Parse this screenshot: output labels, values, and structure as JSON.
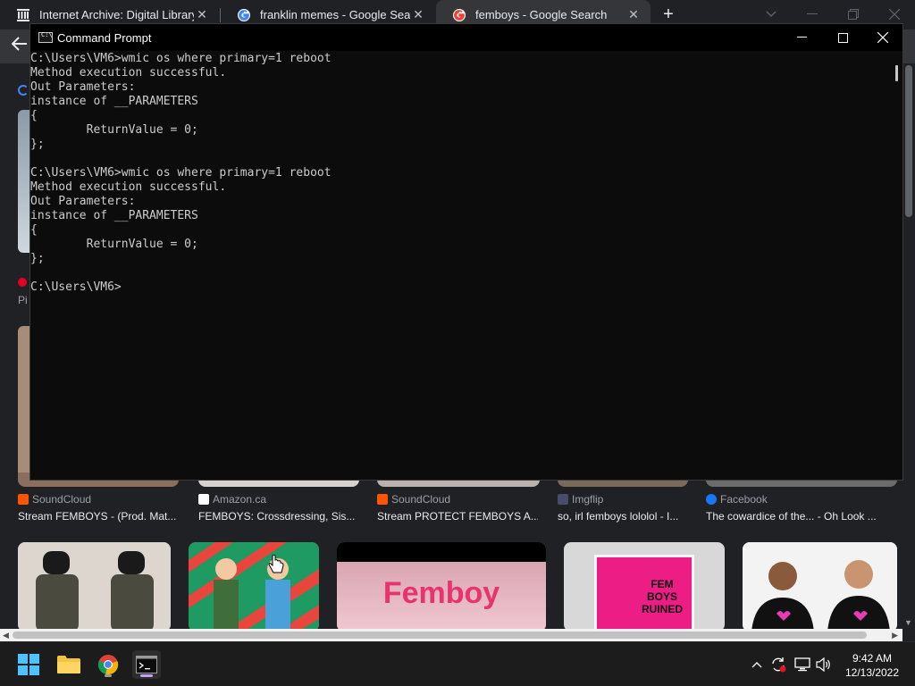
{
  "browser": {
    "tabs": [
      {
        "label": "Internet Archive: Digital Library o",
        "favicon": "archive-icon",
        "active": false
      },
      {
        "label": "franklin memes - Google Search",
        "favicon": "google-icon",
        "active": false
      },
      {
        "label": "femboys - Google Search",
        "favicon": "google-icon",
        "active": true
      }
    ],
    "new_tab_glyph": "+",
    "controls": [
      "chevron-down-icon",
      "minimize-icon",
      "restore-icon",
      "close-icon"
    ]
  },
  "page": {
    "peek_top_text": "Pi",
    "results": [
      {
        "source": "SoundCloud",
        "source_color": "#ff5500",
        "caption": "Stream FEMBOYS - (Prod. Mat..."
      },
      {
        "source": "Amazon.ca",
        "source_color": "#ffffff",
        "caption": "FEMBOYS: Crossdressing, Sis..."
      },
      {
        "source": "SoundCloud",
        "source_color": "#ff5500",
        "caption": "Stream PROTECT FEMBOYS A..."
      },
      {
        "source": "Imgflip",
        "source_color": "#4a4a6a",
        "caption": "so, irl femboys lololol - I..."
      },
      {
        "source": "Facebook",
        "source_color": "#1877f2",
        "caption": "The cowardice of the... - Oh Look ..."
      }
    ],
    "image_texts": {
      "femboy_banner": "Femboy",
      "fem_boys_sign": "FEM BOYS RUINED"
    }
  },
  "cmd": {
    "title": "Command Prompt",
    "output": "C:\\Users\\VM6>wmic os where primary=1 reboot\nMethod execution successful.\nOut Parameters:\ninstance of __PARAMETERS\n{\n        ReturnValue = 0;\n};\n\nC:\\Users\\VM6>wmic os where primary=1 reboot\nMethod execution successful.\nOut Parameters:\ninstance of __PARAMETERS\n{\n        ReturnValue = 0;\n};\n\nC:\\Users\\VM6>"
  },
  "taskbar": {
    "apps": [
      "start-icon",
      "file-explorer-icon",
      "chrome-icon",
      "terminal-icon"
    ],
    "tray": [
      "chevron-up-icon",
      "sync-icon",
      "network-icon",
      "volume-icon"
    ],
    "time": "9:42 AM",
    "date": "12/13/2022"
  },
  "colors": {
    "accent": "#c4a2f5",
    "cmd_bg": "#0c0c0c",
    "cmd_text": "#cccccc",
    "browser_bg": "#202124"
  }
}
